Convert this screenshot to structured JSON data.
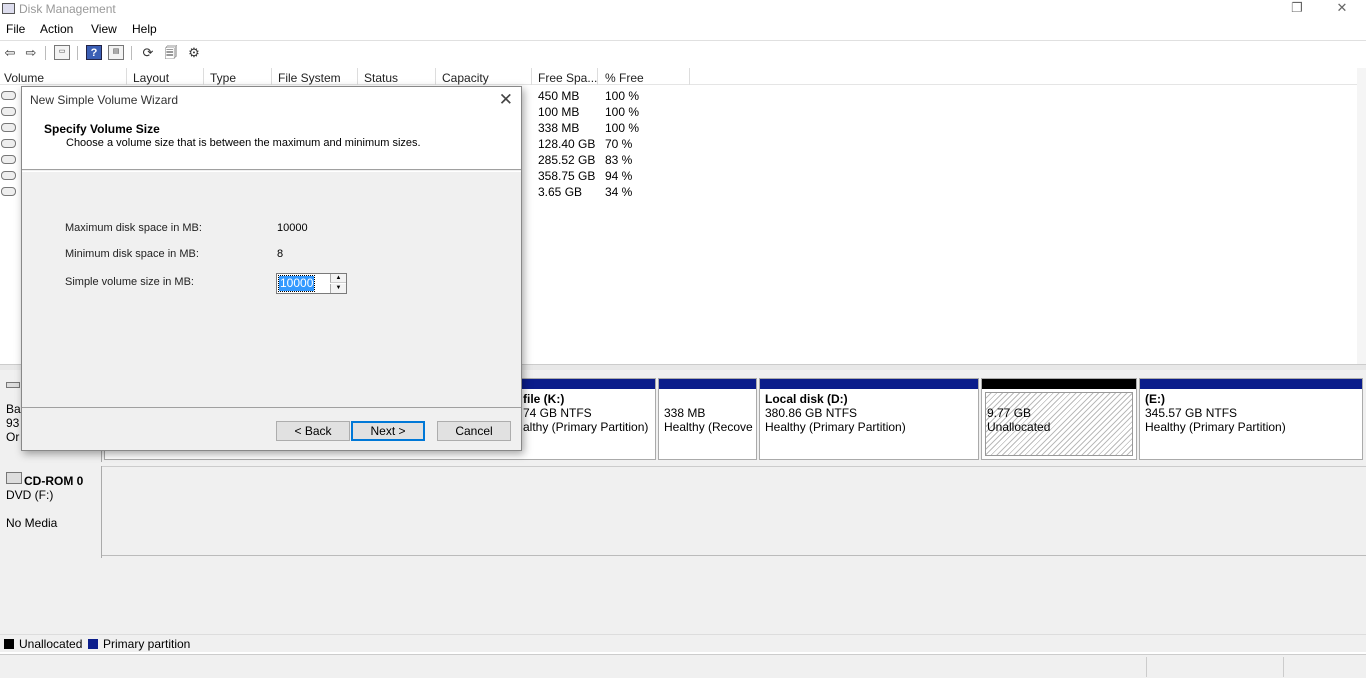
{
  "window": {
    "title": "Disk Management",
    "restore_icon": "restore-icon",
    "close_icon": "close-icon"
  },
  "menu": [
    "File",
    "Action",
    "View",
    "Help"
  ],
  "table": {
    "columns": [
      "Volume",
      "Layout",
      "Type",
      "File System",
      "Status",
      "Capacity",
      "Free Spa...",
      "% Free"
    ],
    "rows": [
      {
        "free": "450 MB",
        "pct": "100 %"
      },
      {
        "free": "100 MB",
        "pct": "100 %"
      },
      {
        "free": "338 MB",
        "pct": "100 %"
      },
      {
        "free": "128.40 GB",
        "pct": "70 %"
      },
      {
        "free": "285.52 GB",
        "pct": "83 %"
      },
      {
        "free": "358.75 GB",
        "pct": "94 %"
      },
      {
        "free": "3.65 GB",
        "pct": "34 %"
      }
    ]
  },
  "disk0": {
    "label_lines": [
      "Ba",
      "93",
      "Or"
    ],
    "partitions": [
      {
        "name": "file  (K:)",
        "size": "74 GB NTFS",
        "status": "althy (Primary Partition)"
      },
      {
        "name": "",
        "size": "338 MB",
        "status": "Healthy (Recove"
      },
      {
        "name": "Local disk  (D:)",
        "size": "380.86 GB NTFS",
        "status": "Healthy (Primary Partition)"
      },
      {
        "name": "",
        "size": "9.77 GB",
        "status": "Unallocated"
      },
      {
        "name": " (E:)",
        "size": "345.57 GB NTFS",
        "status": "Healthy (Primary Partition)"
      }
    ]
  },
  "cdrom": {
    "title": "CD-ROM 0",
    "drive": "DVD (F:)",
    "media": "No Media"
  },
  "legend": {
    "unallocated": "Unallocated",
    "primary": "Primary partition"
  },
  "colors": {
    "primary": "#0b1d8b",
    "unallocated": "#000000",
    "accent": "#0078d7"
  },
  "wizard": {
    "title": "New Simple Volume Wizard",
    "heading": "Specify Volume Size",
    "subheading": "Choose a volume size that is between the maximum and minimum sizes.",
    "max_label": "Maximum disk space in MB:",
    "max_value": "10000",
    "min_label": "Minimum disk space in MB:",
    "min_value": "8",
    "size_label": "Simple volume size in MB:",
    "size_value": "10000",
    "back": "< Back",
    "next": "Next >",
    "cancel": "Cancel"
  }
}
